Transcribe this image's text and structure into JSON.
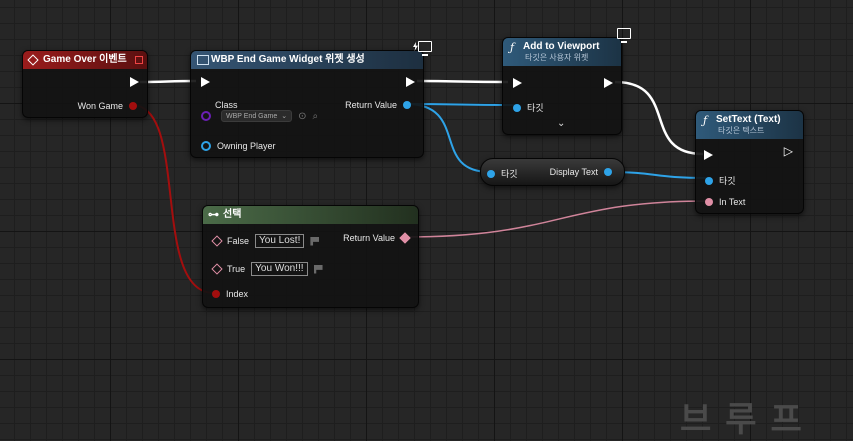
{
  "event_node": {
    "title": "Game Over 이벤트",
    "pin_won_game": "Won Game"
  },
  "create_widget_node": {
    "title": "WBP End Game Widget 위젯 생성",
    "pin_class": "Class",
    "class_value": "WBP End Game",
    "pin_owning_player": "Owning Player",
    "pin_return_value": "Return Value"
  },
  "add_viewport_node": {
    "title": "Add to Viewport",
    "subtitle": "타깃은 사용자 위젯",
    "pin_target": "타깃"
  },
  "get_display_text_node": {
    "pin_target": "타깃",
    "pin_display_text": "Display Text"
  },
  "settext_node": {
    "title": "SetText (Text)",
    "subtitle": "타깃은 텍스트",
    "pin_target": "타깃",
    "pin_in_text": "In Text"
  },
  "select_node": {
    "title": "선택",
    "pin_false": "False",
    "false_value": "You Lost!",
    "pin_true": "True",
    "true_value": "You Won!!!",
    "pin_index": "Index",
    "pin_return_value": "Return Value"
  },
  "watermark": "브루프",
  "colors": {
    "event_header": "#8c1a1a",
    "function_header": "#2b4a66",
    "select_header": "#3e5a3c",
    "object_pin": "#2ea3e8",
    "bool_pin": "#a30e0e",
    "text_pin": "#e08fa6",
    "class_pin": "#6a1fb5"
  },
  "icons": [
    "event-diamond-icon",
    "widget-icon",
    "function-icon",
    "monitor-icon",
    "chevron-down-icon",
    "select-icon"
  ]
}
